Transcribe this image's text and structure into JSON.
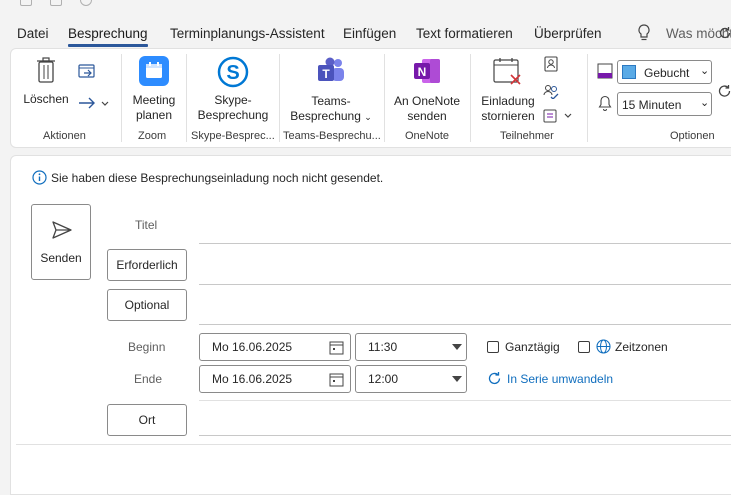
{
  "tabs": [
    {
      "label": "Datei"
    },
    {
      "label": "Besprechung"
    },
    {
      "label": "Terminplanungs-Assistent"
    },
    {
      "label": "Einfügen"
    },
    {
      "label": "Text formatieren"
    },
    {
      "label": "Überprüfen"
    }
  ],
  "search": {
    "label": "Was möcht"
  },
  "ribbon": {
    "aktionen": {
      "delete_label": "Löschen",
      "group": "Aktionen"
    },
    "zoom": {
      "meeting_line1": "Meeting",
      "meeting_line2": "planen",
      "group": "Zoom"
    },
    "skype": {
      "line1": "Skype-",
      "line2": "Besprechung",
      "group": "Skype-Besprec..."
    },
    "teams": {
      "line1": "Teams-",
      "line2": "Besprechung",
      "group": "Teams-Besprechu..."
    },
    "onenote": {
      "line1": "An OneNote",
      "line2": "senden",
      "group": "OneNote"
    },
    "teilnehmer": {
      "line1": "Einladung",
      "line2": "stornieren",
      "group": "Teilnehmer"
    },
    "optionen": {
      "status": "Gebucht",
      "reminder": "15 Minuten",
      "group": "Optionen"
    }
  },
  "info": {
    "text": "Sie haben diese Besprechungseinladung noch nicht gesendet."
  },
  "form": {
    "send": "Senden",
    "title_label": "Titel",
    "required": "Erforderlich",
    "optional": "Optional",
    "start_label": "Beginn",
    "end_label": "Ende",
    "start_date": "Mo 16.06.2025",
    "start_time": "11:30",
    "end_date": "Mo 16.06.2025",
    "end_time": "12:00",
    "allday": "Ganztägig",
    "timezones": "Zeitzonen",
    "series": "In Serie umwandeln",
    "location": "Ort"
  },
  "colors": {
    "accent": "#2b579a",
    "link": "#106ebe",
    "teams": "#5b5fc7",
    "onenote": "#7719aa",
    "zoom": "#2d8cff"
  }
}
